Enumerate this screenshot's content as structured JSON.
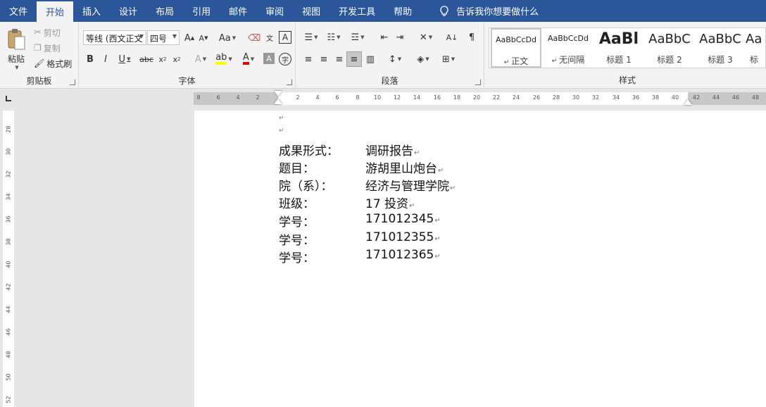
{
  "tabs": [
    "文件",
    "开始",
    "插入",
    "设计",
    "布局",
    "引用",
    "邮件",
    "审阅",
    "视图",
    "开发工具",
    "帮助"
  ],
  "active_tab": "开始",
  "tell_me": "告诉我你想要做什么",
  "clipboard": {
    "paste": "粘贴",
    "cut": "剪切",
    "copy": "复制",
    "format_painter": "格式刷",
    "label": "剪贴板"
  },
  "font": {
    "name": "等线 (西文正文",
    "size": "四号",
    "change_case": "Aa",
    "label": "字体"
  },
  "paragraph": {
    "label": "段落"
  },
  "styles": {
    "label": "样式",
    "items": [
      {
        "sample": "AaBbCcDd",
        "name": "正文"
      },
      {
        "sample": "AaBbCcDd",
        "name": "无间隔"
      },
      {
        "sample": "AaBl",
        "name": "标题 1"
      },
      {
        "sample": "AaBbC",
        "name": "标题 2"
      },
      {
        "sample": "AaBbC",
        "name": "标题 3"
      },
      {
        "sample": "Aa",
        "name": "标"
      }
    ]
  },
  "ruler": {
    "h_left": [
      "8",
      "6",
      "4",
      "2"
    ],
    "h_right": [
      "2",
      "4",
      "6",
      "8",
      "10",
      "12",
      "14",
      "16",
      "18",
      "20",
      "22",
      "24",
      "26",
      "28",
      "30",
      "32",
      "34",
      "36",
      "38",
      "40",
      "42",
      "44",
      "46",
      "48"
    ],
    "v": [
      "28",
      "30",
      "32",
      "34",
      "36",
      "38",
      "40",
      "42",
      "44",
      "46",
      "48",
      "50",
      "52"
    ]
  },
  "document": {
    "rows": [
      {
        "label": "成果形式：",
        "value": "调研报告"
      },
      {
        "label": "题目：",
        "value": "游胡里山炮台"
      },
      {
        "label": "院（系）：",
        "value": "经济与管理学院"
      },
      {
        "label": "班级：",
        "value": "17 投资"
      },
      {
        "label": "学号：",
        "value": "171012345"
      },
      {
        "label": "学号：",
        "value": "171012355"
      },
      {
        "label": "学号：",
        "value": "171012365"
      }
    ],
    "return_mark": "↵"
  }
}
